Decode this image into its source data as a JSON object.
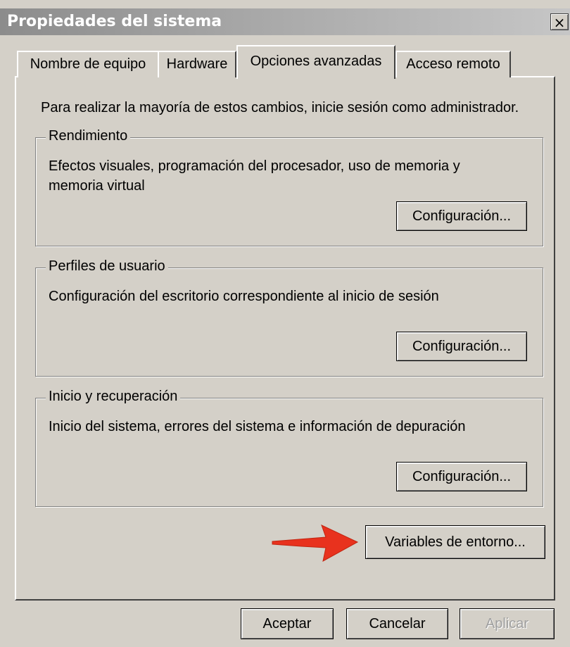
{
  "window": {
    "title": "Propiedades del sistema",
    "close_label": "×"
  },
  "tabs": [
    {
      "label": "Nombre de equipo",
      "active": false
    },
    {
      "label": "Hardware",
      "active": false
    },
    {
      "label": "Opciones avanzadas",
      "active": true
    },
    {
      "label": "Acceso remoto",
      "active": false
    }
  ],
  "note": "Para realizar la mayoría de estos cambios, inicie sesión como administrador.",
  "groups": [
    {
      "title": "Rendimiento",
      "description": "Efectos visuales, programación del procesador, uso de memoria y memoria virtual",
      "button": "Configuración..."
    },
    {
      "title": "Perfiles de usuario",
      "description": "Configuración del escritorio correspondiente al inicio de sesión",
      "button": "Configuración..."
    },
    {
      "title": "Inicio y recuperación",
      "description": "Inicio del sistema, errores del sistema e información de depuración",
      "button": "Configuración..."
    }
  ],
  "env_button": "Variables de entorno...",
  "annotation": {
    "icon": "red-arrow-icon",
    "color": "#e8321e"
  },
  "footer": {
    "ok": "Aceptar",
    "cancel": "Cancelar",
    "apply": "Aplicar",
    "apply_enabled": false
  }
}
